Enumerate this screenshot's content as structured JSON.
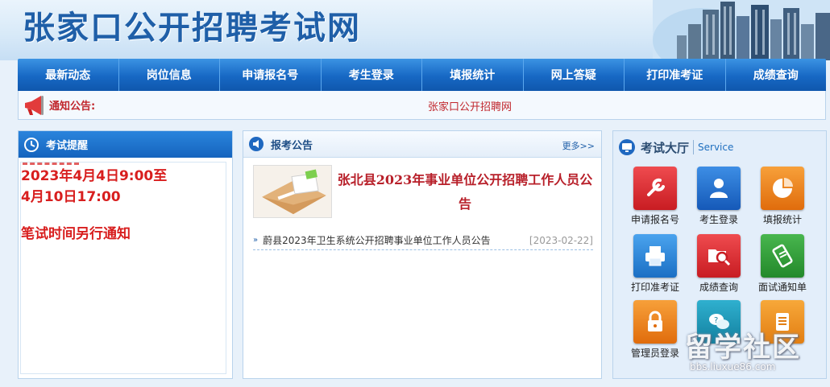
{
  "header": {
    "site_title": "张家口公开招聘考试网"
  },
  "nav": {
    "items": [
      "最新动态",
      "岗位信息",
      "申请报名号",
      "考生登录",
      "填报统计",
      "网上答疑",
      "打印准考证",
      "成绩查询"
    ]
  },
  "notice": {
    "label": "通知公告:",
    "text": "张家口公开招聘网"
  },
  "reminder": {
    "title": "考试提醒",
    "line1": "2023年4月4日9:00至",
    "line2": "4月10日17:00",
    "line3": "笔试时间另行通知"
  },
  "announcements": {
    "title": "报考公告",
    "more": "更多>>",
    "featured_title": "张北县2023年事业单位公开招聘工作人员公告",
    "items": [
      {
        "title": "蔚县2023年卫生系统公开招聘事业单位工作人员公告",
        "date": "[2023-02-22]"
      }
    ]
  },
  "hall": {
    "title": "考试大厅",
    "subtitle": "Service",
    "services": [
      {
        "label": "申请报名号",
        "color": "#d8262c",
        "icon": "wrench-icon"
      },
      {
        "label": "考生登录",
        "color": "#1f6fd0",
        "icon": "user-icon"
      },
      {
        "label": "填报统计",
        "color": "#ee7a12",
        "icon": "pie-chart-icon"
      },
      {
        "label": "打印准考证",
        "color": "#2a88d6",
        "icon": "printer-icon"
      },
      {
        "label": "成绩查询",
        "color": "#d8262c",
        "icon": "folder-search-icon"
      },
      {
        "label": "面试通知单",
        "color": "#2d9a35",
        "icon": "document-icon"
      },
      {
        "label": "管理员登录",
        "color": "#ef7d14",
        "icon": "lock-icon"
      },
      {
        "label": "",
        "color": "#1a8fb0",
        "icon": "chat-bubbles-icon"
      },
      {
        "label": "",
        "color": "#ee8a14",
        "icon": "notepad-icon"
      }
    ]
  },
  "watermark": {
    "big": "留学社区",
    "small": "bbs.liuxue86.com"
  }
}
